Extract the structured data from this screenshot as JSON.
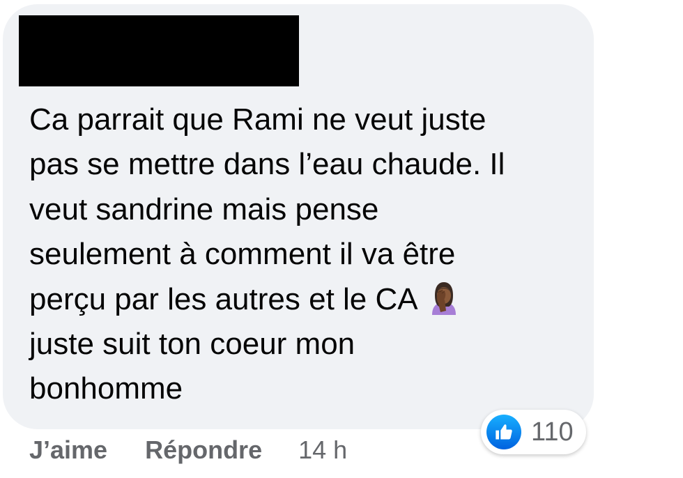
{
  "comment": {
    "author_name": "",
    "text_lines": [
      "Ca parrait que Rami ne veut juste",
      "pas se mettre dans l’eau chaude. Il",
      "veut sandrine mais pense",
      "seulement à comment il va être",
      "perçu par les autres et le CA",
      "juste suit ton coeur mon",
      "bonhomme"
    ],
    "inline_emoji": "woman-facepalming-emoji"
  },
  "reactions": {
    "icon": "thumbs-up-icon",
    "count": "110",
    "badge_color": "#1877f2"
  },
  "actions": {
    "like_label": "J’aime",
    "reply_label": "Répondre",
    "timestamp": "14 h"
  },
  "colors": {
    "bubble_background": "#f0f2f5",
    "text": "#050505",
    "secondary_text": "#65676b"
  }
}
